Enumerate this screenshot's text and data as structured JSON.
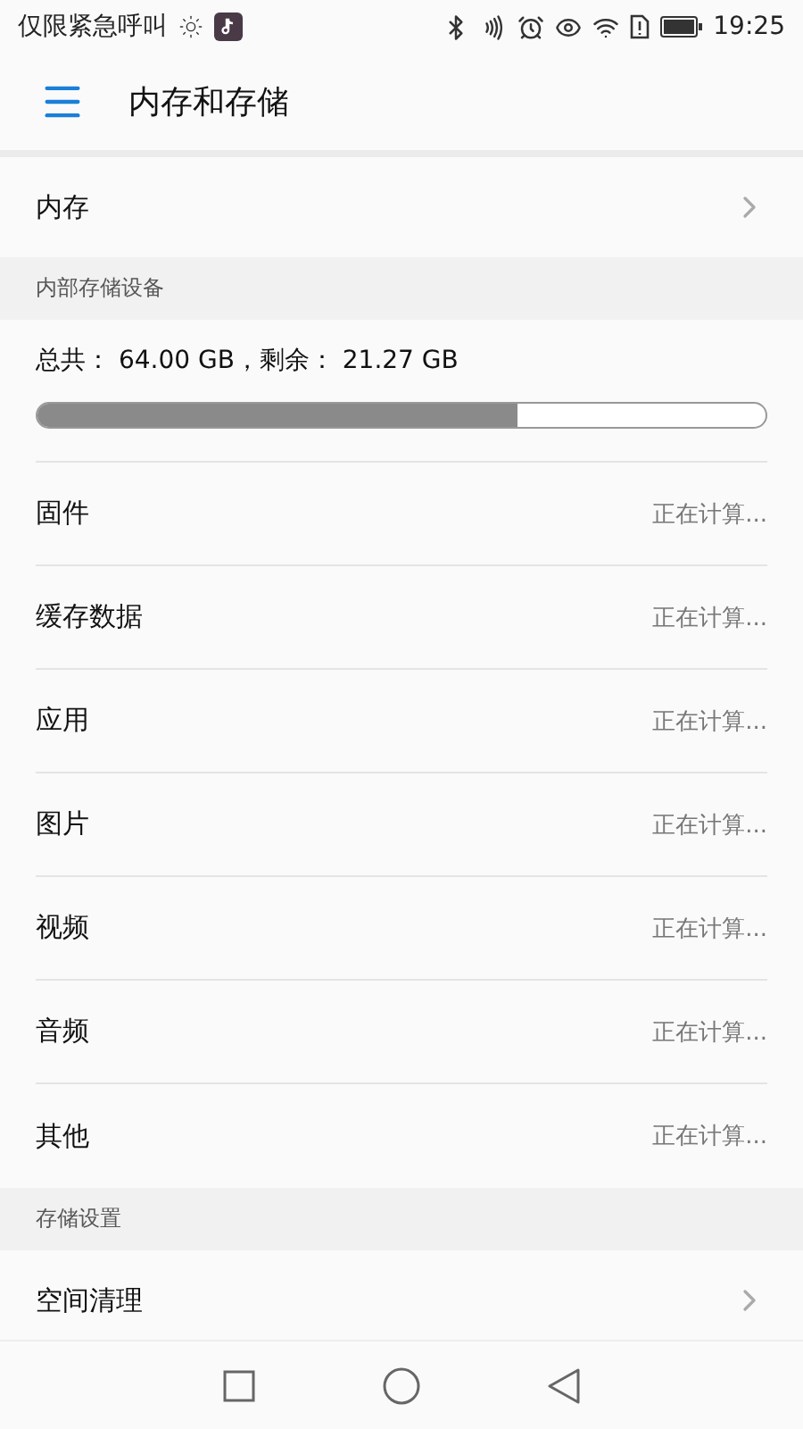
{
  "status_bar": {
    "carrier": "仅限紧急呼叫",
    "time": "19:25"
  },
  "header": {
    "title": "内存和存储"
  },
  "memory_row": {
    "label": "内存"
  },
  "internal_section": {
    "title": "内部存储设备",
    "summary": "总共： 64.00 GB，剩余： 21.27 GB",
    "level": 0.66
  },
  "categories": [
    {
      "label": "固件",
      "value": "正在计算..."
    },
    {
      "label": "缓存数据",
      "value": "正在计算..."
    },
    {
      "label": "应用",
      "value": "正在计算..."
    },
    {
      "label": "图片",
      "value": "正在计算..."
    },
    {
      "label": "视频",
      "value": "正在计算..."
    },
    {
      "label": "音频",
      "value": "正在计算..."
    },
    {
      "label": "其他",
      "value": "正在计算..."
    }
  ],
  "settings_section": {
    "title": "存储设置",
    "items": [
      {
        "label": "空间清理"
      }
    ]
  }
}
